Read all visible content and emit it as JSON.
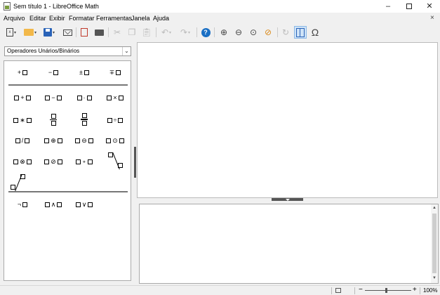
{
  "window": {
    "title": "Sem título 1 - LibreOffice Math",
    "minimize_glyph": "–",
    "close_glyph": "✕"
  },
  "menubar": {
    "items": [
      "Arquivo",
      "Editar",
      "Exibir",
      "Formatar",
      "Ferramentas",
      "Janela",
      "Ajuda"
    ],
    "close_glyph": "×"
  },
  "toolbar": {
    "icons": [
      "formula-icon",
      "open-folder-icon",
      "save-icon",
      "email-icon",
      "export-pdf-icon",
      "print-icon",
      "cut-icon",
      "copy-icon",
      "paste-icon",
      "undo-icon",
      "redo-icon",
      "help-icon",
      "zoom-in-icon",
      "zoom-out-icon",
      "zoom-100-icon",
      "show-all-icon",
      "update-icon",
      "formula-cursor-icon",
      "symbols-icon"
    ],
    "help_label": "?",
    "symbols_label": "Ω"
  },
  "elements": {
    "category": "Operadores Unários/Binários",
    "unary": [
      "+",
      "−",
      "±",
      "∓"
    ],
    "binary_row1": [
      "+",
      "−",
      "·",
      "×"
    ],
    "binary_row2": [
      "∗",
      "÷"
    ],
    "binary_row3": [
      "/",
      "⊕",
      "⊖",
      "⊙"
    ],
    "binary_row4": [
      "⊗",
      "⊘",
      "∘"
    ],
    "logic": [
      "¬",
      "∧",
      "∨"
    ]
  },
  "statusbar": {
    "zoom_minus": "−",
    "zoom_plus": "+",
    "zoom_level": "100%",
    "zoom_fraction": 0.45
  },
  "colors": {
    "accent": "#1a6fc4",
    "active_toggle": "#cfe3f7",
    "panel_bg": "#f0f0f0"
  }
}
